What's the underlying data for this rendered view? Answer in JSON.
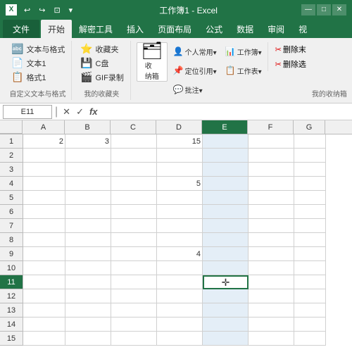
{
  "titlebar": {
    "icon": "X",
    "filename": "工作簿1 - Excel",
    "quickaccess": [
      "↩",
      "↪",
      "⊡",
      "▾"
    ],
    "controls": [
      "—",
      "□",
      "✕"
    ]
  },
  "tabs": [
    {
      "label": "文件",
      "active": false,
      "file": true
    },
    {
      "label": "开始",
      "active": true
    },
    {
      "label": "解密工具",
      "active": false
    },
    {
      "label": "插入",
      "active": false
    },
    {
      "label": "页面布局",
      "active": false
    },
    {
      "label": "公式",
      "active": false
    },
    {
      "label": "数据",
      "active": false
    },
    {
      "label": "审阅",
      "active": false
    },
    {
      "label": "视",
      "active": false
    }
  ],
  "ribbon": {
    "groups": [
      {
        "name": "自定义文本与格式",
        "label": "自定义文本与格式",
        "items_col": [
          {
            "icon": "🔤",
            "label": "文本与格式"
          },
          {
            "icon": "📄",
            "label": "文本1"
          },
          {
            "icon": "📋",
            "label": "格式1"
          }
        ]
      },
      {
        "name": "我的收藏夹",
        "label": "我的收藏夹",
        "items_col": [
          {
            "icon": "⭐",
            "label": "收藏夹"
          },
          {
            "icon": "💾",
            "label": "C盘"
          },
          {
            "icon": "🎬",
            "label": "GIF录制"
          }
        ]
      },
      {
        "name": "收纳箱",
        "label": "",
        "big_items": [
          {
            "icon": "🗂",
            "label": "收\n纳箱"
          }
        ]
      },
      {
        "name": "个人常用",
        "label": "",
        "big_items": [
          {
            "icon": "👤",
            "label": "个人常\n用▾"
          }
        ]
      },
      {
        "name": "定位引用",
        "label": "",
        "big_items": [
          {
            "icon": "📌",
            "label": "定位引\n用▾"
          }
        ]
      },
      {
        "name": "批注",
        "label": "",
        "big_items": [
          {
            "icon": "💬",
            "label": "批注▾"
          }
        ]
      },
      {
        "name": "工作簿",
        "label": "",
        "big_items": [
          {
            "icon": "📊",
            "label": "工作\n簿▾"
          }
        ]
      },
      {
        "name": "工作表",
        "label": "我的收纳箱",
        "big_items": [
          {
            "icon": "📋",
            "label": "工作\n表▾"
          }
        ]
      },
      {
        "name": "删除组",
        "label": "",
        "del_items": [
          {
            "label": "删除末"
          },
          {
            "label": "删除选"
          }
        ]
      }
    ]
  },
  "formulabar": {
    "namebox": "E11",
    "btns": [
      "✕",
      "✓",
      "fx"
    ],
    "formula": ""
  },
  "grid": {
    "columns": [
      "A",
      "B",
      "C",
      "D",
      "E",
      "F",
      "G"
    ],
    "rows": 15,
    "selected_col": "E",
    "selected_row": 11,
    "cells": {
      "A1": "2",
      "B1": "3",
      "D1": "15",
      "D4": "5",
      "D9": "4"
    }
  }
}
